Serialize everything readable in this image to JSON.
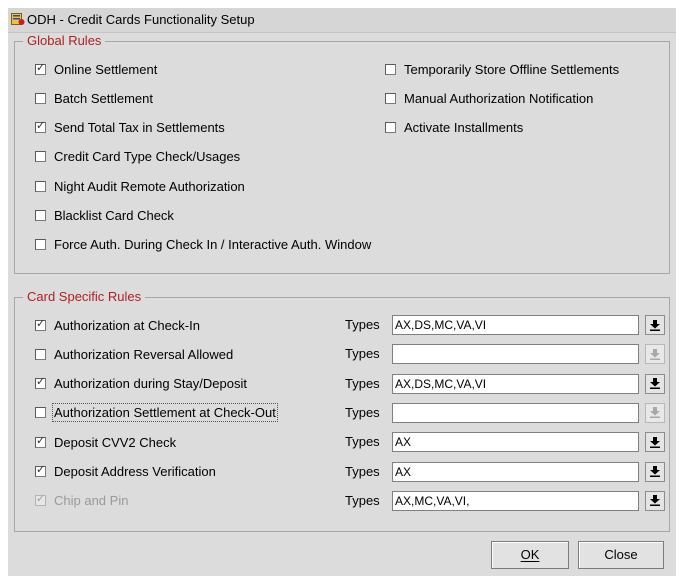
{
  "window": {
    "title": "ODH - Credit Cards Functionality Setup",
    "icon": "app-icon"
  },
  "global_rules": {
    "legend": "Global Rules",
    "left": [
      {
        "label": "Online Settlement",
        "checked": true
      },
      {
        "label": "Batch Settlement",
        "checked": false
      },
      {
        "label": "Send Total Tax in Settlements",
        "checked": true
      },
      {
        "label": "Credit Card Type Check/Usages",
        "checked": false
      },
      {
        "label": "Night Audit Remote Authorization",
        "checked": false
      },
      {
        "label": "Blacklist Card Check",
        "checked": false
      },
      {
        "label": "Force Auth. During Check In / Interactive Auth. Window",
        "checked": false
      }
    ],
    "right": [
      {
        "label": "Temporarily Store Offline Settlements",
        "checked": false
      },
      {
        "label": "Manual  Authorization Notification",
        "checked": false
      },
      {
        "label": "Activate Installments",
        "checked": false
      }
    ]
  },
  "card_rules": {
    "legend": "Card Specific Rules",
    "types_label": "Types",
    "rows": [
      {
        "label": "Authorization at Check-In",
        "checked": true,
        "types": "AX,DS,MC,VA,VI",
        "enabled": true,
        "dd_enabled": true
      },
      {
        "label": "Authorization Reversal Allowed",
        "checked": false,
        "types": "",
        "enabled": true,
        "dd_enabled": false
      },
      {
        "label": "Authorization during Stay/Deposit",
        "checked": true,
        "types": "AX,DS,MC,VA,VI",
        "enabled": true,
        "dd_enabled": true
      },
      {
        "label": "Authorization Settlement at Check-Out",
        "checked": false,
        "types": "",
        "enabled": true,
        "dd_enabled": false
      },
      {
        "label": "Deposit CVV2 Check",
        "checked": true,
        "types": "AX",
        "enabled": true,
        "dd_enabled": true
      },
      {
        "label": "Deposit Address Verification",
        "checked": true,
        "types": "AX",
        "enabled": true,
        "dd_enabled": true
      },
      {
        "label": "Chip and Pin",
        "checked": true,
        "types": "AX,MC,VA,VI,",
        "enabled": false,
        "dd_enabled": true
      }
    ]
  },
  "buttons": {
    "ok": "OK",
    "close": "Close"
  },
  "colors": {
    "legend_text": "#b02020",
    "window_bg": "#dcdcdc"
  }
}
